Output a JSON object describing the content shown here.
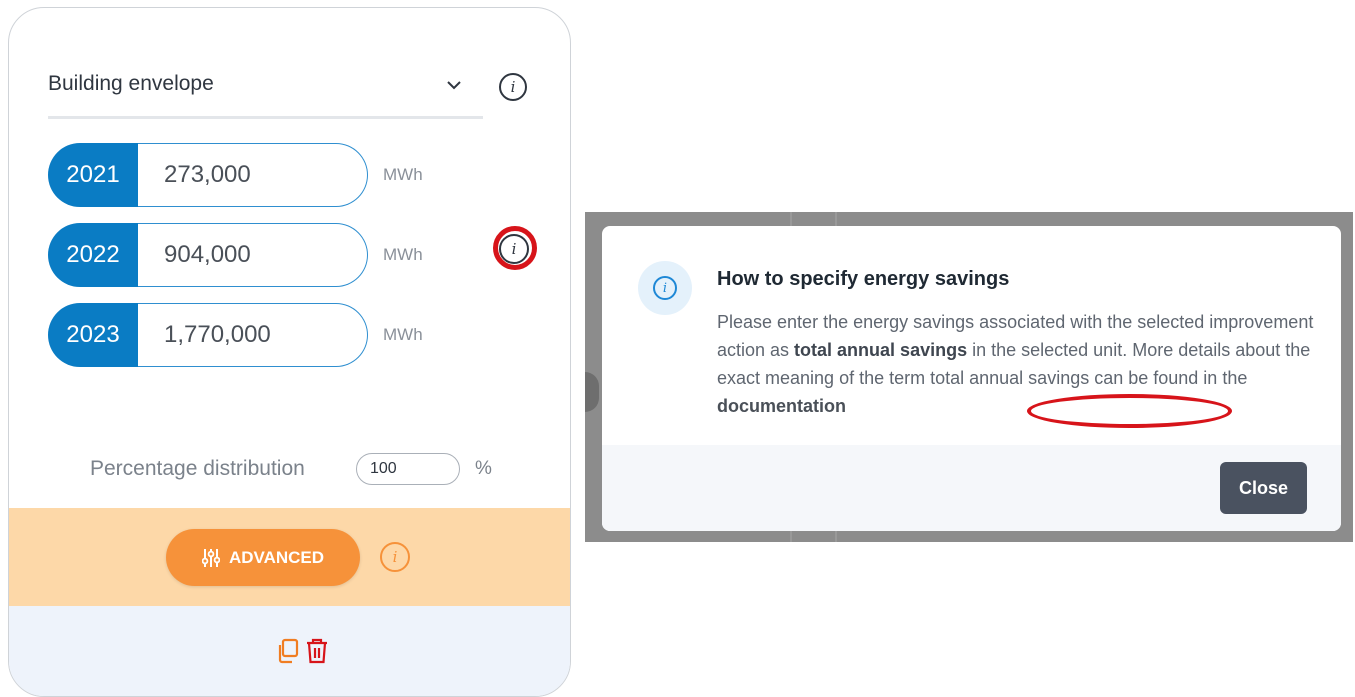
{
  "category": {
    "selected": "Building envelope"
  },
  "savings": [
    {
      "year": "2021",
      "value": "273,000",
      "unit": "MWh"
    },
    {
      "year": "2022",
      "value": "904,000",
      "unit": "MWh"
    },
    {
      "year": "2023",
      "value": "1,770,000",
      "unit": "MWh"
    }
  ],
  "percentage": {
    "label": "Percentage distribution",
    "value": "100",
    "symbol": "%"
  },
  "advanced": {
    "label": "ADVANCED"
  },
  "dialog": {
    "title": "How to specify energy savings",
    "body_1": "Please enter the energy savings associated with the selected improvement action as ",
    "body_bold": "total annual savings",
    "body_2": " in the selected unit. More details about the exact meaning of the term total annual savings can be found in the ",
    "link": "documentation",
    "close_label": "Close"
  },
  "colors": {
    "primary": "#0a7cc4",
    "accent": "#f6923a",
    "highlight": "#d7141a"
  }
}
